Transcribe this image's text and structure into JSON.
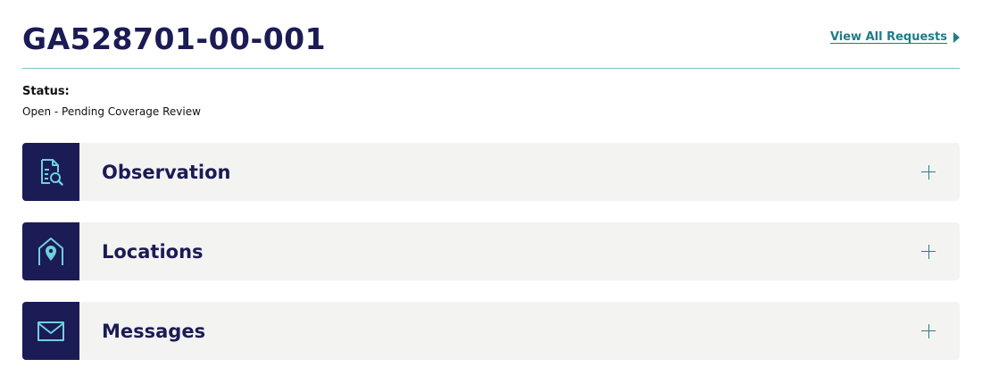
{
  "header": {
    "request_id": "GA528701-00-001",
    "view_all_label": "View All Requests"
  },
  "status": {
    "label": "Status:",
    "value": "Open - Pending Coverage Review"
  },
  "sections": [
    {
      "title": "Observation",
      "icon": "document-search-icon",
      "toggle": "expand-plus-icon"
    },
    {
      "title": "Locations",
      "icon": "home-location-pin-icon",
      "toggle": "expand-plus-icon"
    },
    {
      "title": "Messages",
      "icon": "envelope-icon",
      "toggle": "expand-plus-icon"
    }
  ],
  "colors": {
    "navy": "#1b1b55",
    "teal": "#1f7c86",
    "icon_teal": "#6fd0dc",
    "section_bg": "#f3f3f2",
    "divider": "#7fc3c8"
  }
}
